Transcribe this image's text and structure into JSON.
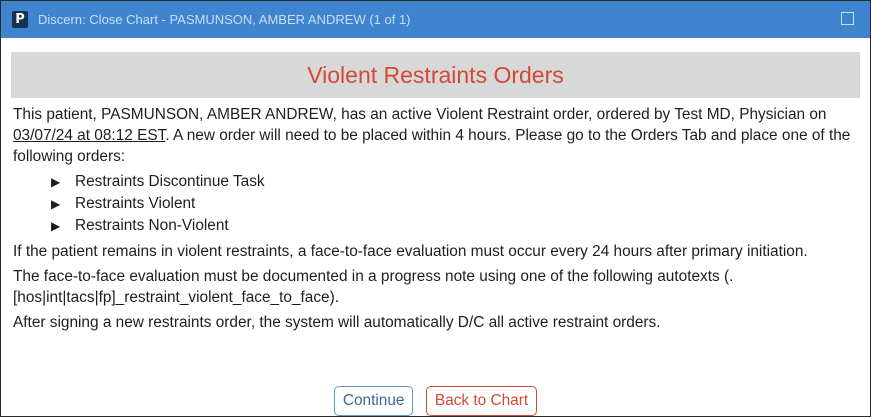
{
  "window": {
    "title": "Discern: Close Chart - PASMUNSON, AMBER ANDREW (1 of 1)",
    "app_icon_letter": "P",
    "maximize_icon": "maximize-icon"
  },
  "dialog": {
    "heading": "Violent Restraints Orders",
    "intro_part1": "This patient, PASMUNSON, AMBER ANDREW, has an active Violent Restraint order, ordered by Test MD, Physician on ",
    "intro_date": "03/07/24 at 08:12 EST",
    "intro_part2": ". A new order will need to be placed within 4 hours. Please go to the Orders Tab and place one of the following orders:",
    "orders": [
      "Restraints Discontinue Task",
      "Restraints Violent",
      "Restraints Non-Violent"
    ],
    "bullet_glyph": "▶",
    "paragraph_face_to_face": "If the patient remains in violent restraints, a face-to-face evaluation must occur every 24 hours after primary initiation.",
    "paragraph_documentation": "The face-to-face evaluation must be documented in a progress note using one of the following autotexts (.[hos|int|tacs|fp]_restraint_violent_face_to_face).",
    "paragraph_dc": "After signing a new restraints order, the system will automatically D/C all active restraint orders."
  },
  "buttons": {
    "continue_label": "Continue",
    "back_label": "Back to Chart"
  },
  "colors": {
    "titlebar": "#3f84cf",
    "heading_text": "#d04a34",
    "heading_band": "#d8d8d8",
    "continue_border": "#5e9bd0",
    "back_border": "#d04a34"
  }
}
